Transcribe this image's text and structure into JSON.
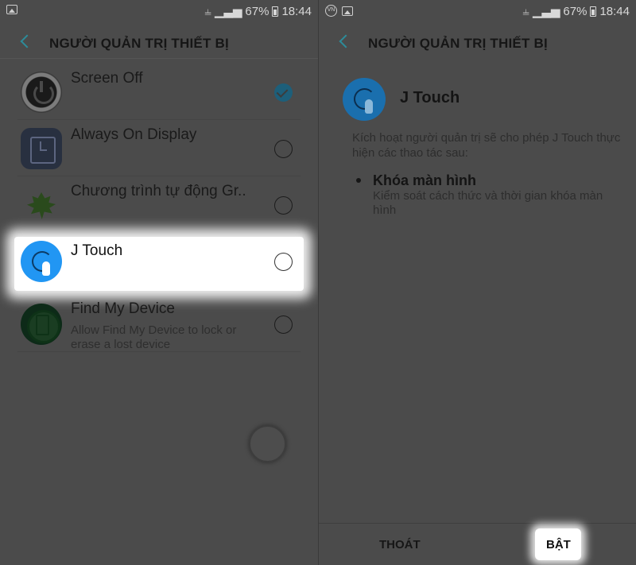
{
  "status_bar": {
    "battery": "67%",
    "time": "18:44"
  },
  "left_screen": {
    "title": "NGƯỜI QUẢN TRỊ THIẾT BỊ",
    "items": [
      {
        "label": "Screen Off",
        "checked": true
      },
      {
        "label": "Always On Display",
        "checked": false
      },
      {
        "label": "Chương trình tự động Gr..",
        "checked": false
      },
      {
        "label": "J Touch",
        "checked": false
      },
      {
        "label": "Find My Device",
        "sublabel": "Allow Find My Device to lock or erase a lost device",
        "checked": false
      }
    ]
  },
  "right_screen": {
    "title": "NGƯỜI QUẢN TRỊ THIẾT BỊ",
    "app_name": "J Touch",
    "description": "Kích hoạt người quản trị sẽ cho phép J Touch thực hiện các thao tác sau:",
    "permission_title": "Khóa màn hình",
    "permission_desc": "Kiểm soát cách thức và thời gian khóa màn hình",
    "exit_label": "THOÁT",
    "enable_label": "BẬT"
  },
  "colors": {
    "accent": "#2196f3",
    "dim_overlay": "#4b4b4b",
    "highlight": "#ffffff"
  }
}
